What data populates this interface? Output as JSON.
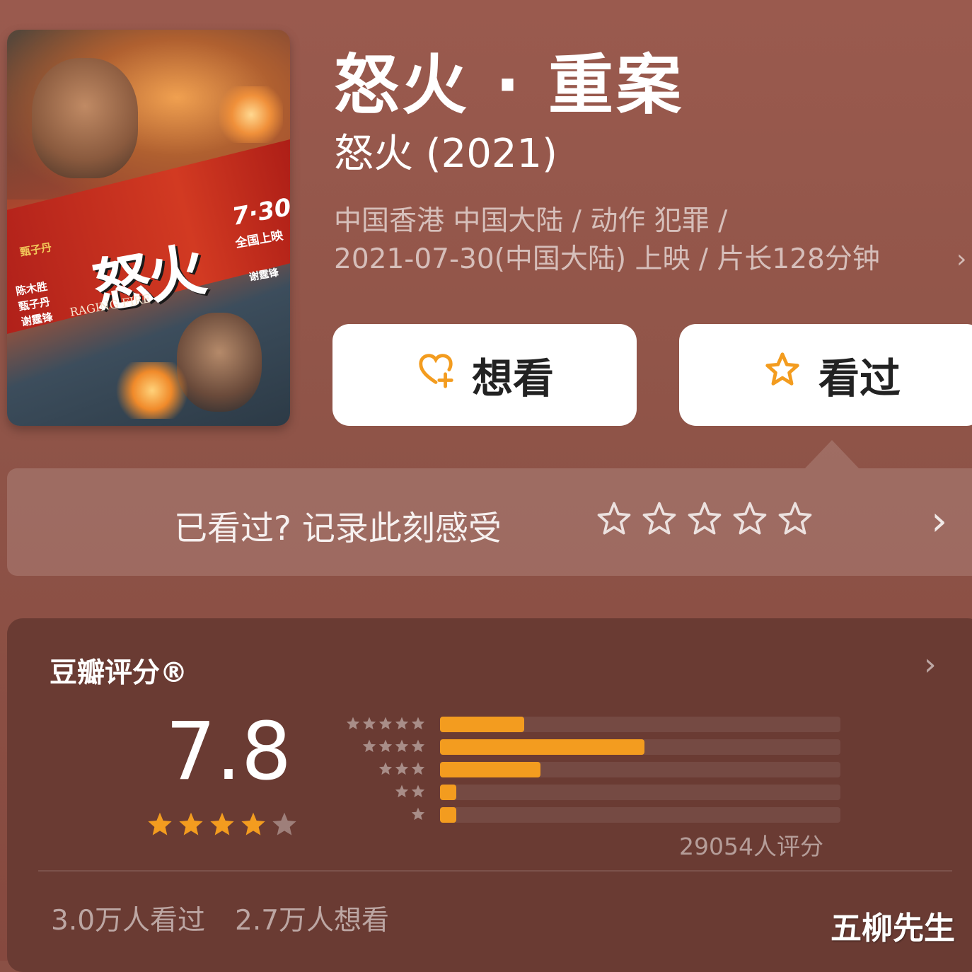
{
  "movie": {
    "title": "怒火 · 重案",
    "original_title": "怒火 (2021)",
    "meta_line1": "中国香港 中国大陆 / 动作 犯罪 /",
    "meta_line2": "2021-07-30(中国大陆) 上映 / 片长128分钟",
    "poster": {
      "title_text": "怒火",
      "date_text": "7·30",
      "release_text": "全国上映",
      "english_title": "RAGING FIRE",
      "cast_left": "甄子丹",
      "cast_lines": [
        "陈木胜",
        "甄子丹",
        "谢霆锋"
      ],
      "cast_right": "谢霆锋"
    }
  },
  "actions": {
    "want_label": "想看",
    "want_icon": "heart-plus-icon",
    "seen_label": "看过",
    "seen_icon": "star-outline-icon"
  },
  "record": {
    "prompt": "已看过? 记录此刻感受",
    "star_count": 5,
    "chevron": "›"
  },
  "rating": {
    "label": "豆瓣评分®",
    "score": "7.8",
    "stars_filled": 4,
    "stars_total": 5,
    "distribution": [
      {
        "stars": 5,
        "fraction": 0.21
      },
      {
        "stars": 4,
        "fraction": 0.51
      },
      {
        "stars": 3,
        "fraction": 0.25
      },
      {
        "stars": 2,
        "fraction": 0.04
      },
      {
        "stars": 1,
        "fraction": 0.04
      }
    ],
    "count_text": "29054人评分",
    "seen_text": "3.0万人看过",
    "want_text": "2.7万人想看"
  },
  "watermark": "五柳先生",
  "colors": {
    "accent": "#f39c1f",
    "card_bg": "#6a3b33",
    "page_bg": "#8f5448"
  }
}
